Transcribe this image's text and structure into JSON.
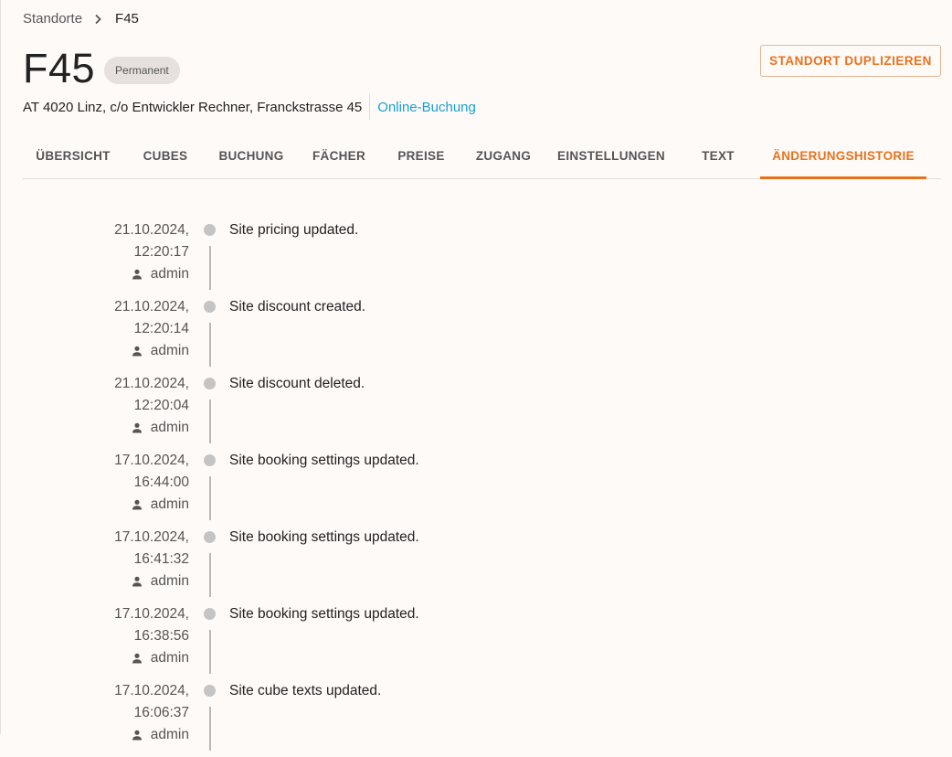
{
  "breadcrumb": {
    "parent": "Standorte",
    "current": "F45"
  },
  "header": {
    "title": "F45",
    "badge": "Permanent",
    "duplicate_button": "STANDORT DUPLIZIEREN",
    "address": "AT 4020 Linz, c/o Entwickler Rechner, Franckstrasse 45",
    "online_booking": "Online-Buchung"
  },
  "tabs": [
    {
      "label": "ÜBERSICHT"
    },
    {
      "label": "CUBES"
    },
    {
      "label": "BUCHUNG"
    },
    {
      "label": "FÄCHER"
    },
    {
      "label": "PREISE"
    },
    {
      "label": "ZUGANG"
    },
    {
      "label": "EINSTELLUNGEN"
    },
    {
      "label": "TEXT"
    },
    {
      "label": "ÄNDERUNGSHISTORIE"
    }
  ],
  "active_tab": "ÄNDERUNGSHISTORIE",
  "history": [
    {
      "date": "21.10.2024,",
      "time": "12:20:17",
      "user": "admin",
      "message": "Site pricing updated."
    },
    {
      "date": "21.10.2024,",
      "time": "12:20:14",
      "user": "admin",
      "message": "Site discount created."
    },
    {
      "date": "21.10.2024,",
      "time": "12:20:04",
      "user": "admin",
      "message": "Site discount deleted."
    },
    {
      "date": "17.10.2024,",
      "time": "16:44:00",
      "user": "admin",
      "message": "Site booking settings updated."
    },
    {
      "date": "17.10.2024,",
      "time": "16:41:32",
      "user": "admin",
      "message": "Site booking settings updated."
    },
    {
      "date": "17.10.2024,",
      "time": "16:38:56",
      "user": "admin",
      "message": "Site booking settings updated."
    },
    {
      "date": "17.10.2024,",
      "time": "16:06:37",
      "user": "admin",
      "message": "Site cube texts updated."
    }
  ],
  "colors": {
    "accent": "#e8721c",
    "link": "#1a9fd0",
    "background": "#fefaf8"
  }
}
